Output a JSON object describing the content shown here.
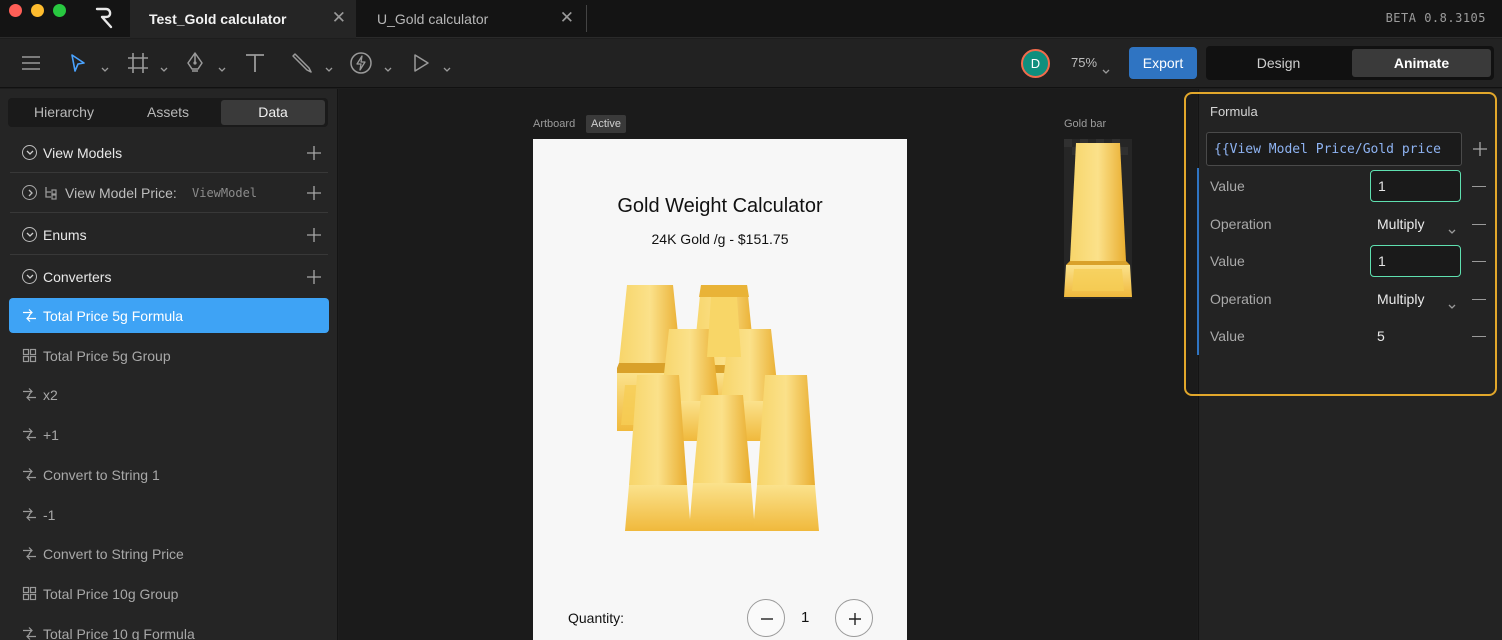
{
  "window": {
    "tabs": [
      {
        "label": "Test_Gold calculator",
        "close": "✕"
      },
      {
        "label": "U_Gold calculator",
        "close": "✕"
      }
    ],
    "version": "BETA 0.8.3105"
  },
  "toolbar": {
    "avatar_initial": "D",
    "zoom": "75%",
    "export_label": "Export",
    "modes": {
      "design": "Design",
      "animate": "Animate"
    }
  },
  "left_panel": {
    "tabs": {
      "hierarchy": "Hierarchy",
      "assets": "Assets",
      "data": "Data"
    },
    "sections": {
      "view_models": "View Models",
      "view_model_item": {
        "label": "View Model  Price",
        "colon": ":",
        "type": "ViewModel"
      },
      "enums": "Enums",
      "converters": "Converters"
    },
    "converters": [
      {
        "label": "Total Price 5g Formula",
        "kind": "formula",
        "selected": true
      },
      {
        "label": "Total Price 5g Group",
        "kind": "group"
      },
      {
        "label": "x2",
        "kind": "formula"
      },
      {
        "label": "+1",
        "kind": "formula"
      },
      {
        "label": "Convert to String 1",
        "kind": "formula"
      },
      {
        "label": "-1",
        "kind": "formula"
      },
      {
        "label": "Convert to String Price",
        "kind": "formula"
      },
      {
        "label": "Total Price 10g Group",
        "kind": "group"
      },
      {
        "label": "Total Price 10 g Formula",
        "kind": "formula"
      }
    ]
  },
  "canvas": {
    "artboard_label": "Artboard",
    "active_badge": "Active",
    "artboard": {
      "title": "Gold Weight Calculator",
      "subtitle": "24K Gold /g - $151.75",
      "quantity_label": "Quantity:",
      "quantity_value": "1"
    },
    "gold_bar_label": "Gold bar"
  },
  "formula": {
    "title": "Formula",
    "expression": "{{View Model  Price/Gold price",
    "rows": [
      {
        "label": "Value",
        "value": "1",
        "kind": "input"
      },
      {
        "label": "Operation",
        "value": "Multiply",
        "kind": "select"
      },
      {
        "label": "Value",
        "value": "1",
        "kind": "input"
      },
      {
        "label": "Operation",
        "value": "Multiply",
        "kind": "select"
      },
      {
        "label": "Value",
        "value": "5",
        "kind": "static"
      }
    ]
  },
  "colors": {
    "accent": "#2f74c2",
    "selection": "#3ea3f5",
    "highlight_border": "#e2a72b",
    "input_border": "#5fe0b0",
    "gold": "#f2b93a"
  }
}
